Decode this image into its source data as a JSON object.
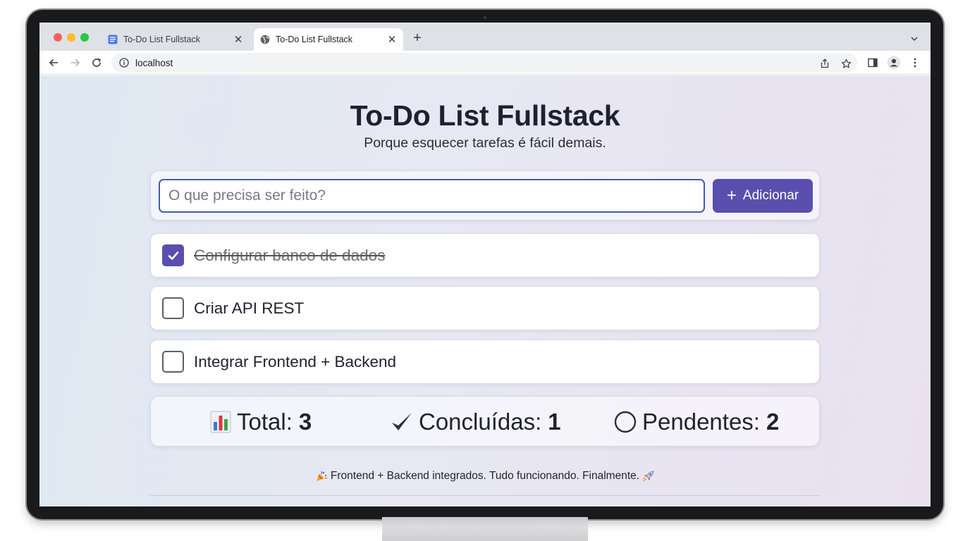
{
  "browser": {
    "tabs": [
      {
        "title": "To-Do List Fullstack",
        "active": false,
        "favicon": "document-icon"
      },
      {
        "title": "To-Do List Fullstack",
        "active": true,
        "favicon": "globe-icon"
      }
    ],
    "url": "localhost"
  },
  "app": {
    "title": "To-Do List Fullstack",
    "subtitle": "Porque esquecer tarefas é fácil demais.",
    "input_placeholder": "O que precisa ser feito?",
    "add_button_label": "Adicionar",
    "accent_color": "#5a4fae"
  },
  "tasks": [
    {
      "text": "Configurar banco de dados",
      "done": true
    },
    {
      "text": "Criar API REST",
      "done": false
    },
    {
      "text": "Integrar Frontend + Backend",
      "done": false
    }
  ],
  "stats": {
    "total_label": "Total:",
    "total_value": "3",
    "done_label": "Concluídas:",
    "done_value": "1",
    "pending_label": "Pendentes:",
    "pending_value": "2"
  },
  "footer": {
    "message": "Frontend + Backend integrados. Tudo funcionando. Finalmente."
  }
}
